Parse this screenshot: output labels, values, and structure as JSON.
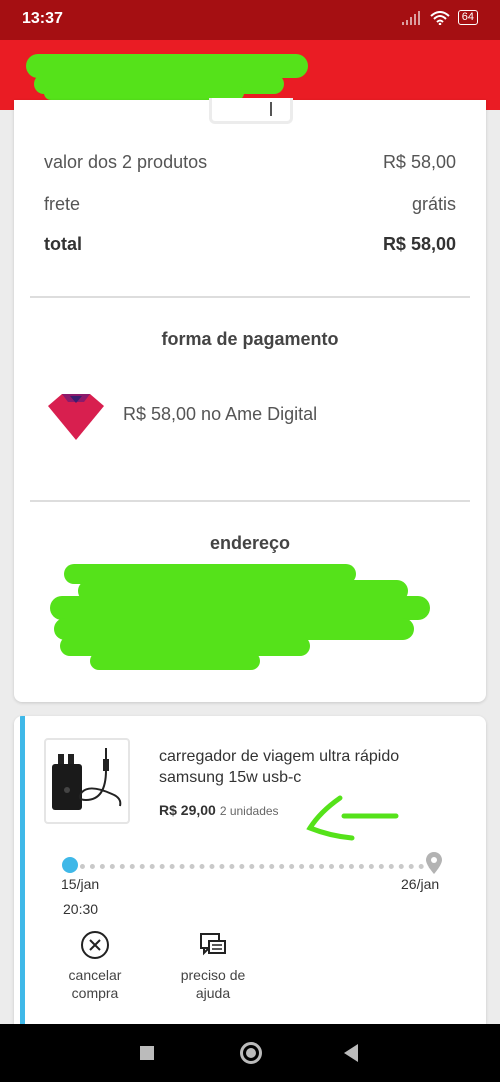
{
  "status_bar": {
    "time": "13:37",
    "battery": "64"
  },
  "summary": {
    "items_label": "valor dos 2 produtos",
    "items_value": "R$ 58,00",
    "shipping_label": "frete",
    "shipping_value": "grátis",
    "total_label": "total",
    "total_value": "R$ 58,00"
  },
  "payment": {
    "title": "forma de pagamento",
    "method": "R$ 58,00 no Ame Digital"
  },
  "address": {
    "title": "endereço"
  },
  "order": {
    "product_name": "carregador de viagem ultra rápido samsung 15w usb-c",
    "price": "R$ 29,00",
    "quantity": "2 unidades",
    "start_date": "15/jan",
    "start_time": "20:30",
    "end_date": "26/jan",
    "actions": {
      "cancel": "cancelar compra",
      "help": "preciso de ajuda"
    }
  },
  "colors": {
    "header_red": "#ea1c24",
    "status_red": "#a50f12",
    "accent_blue": "#3fb8e8",
    "redaction_green": "#55e21a"
  }
}
